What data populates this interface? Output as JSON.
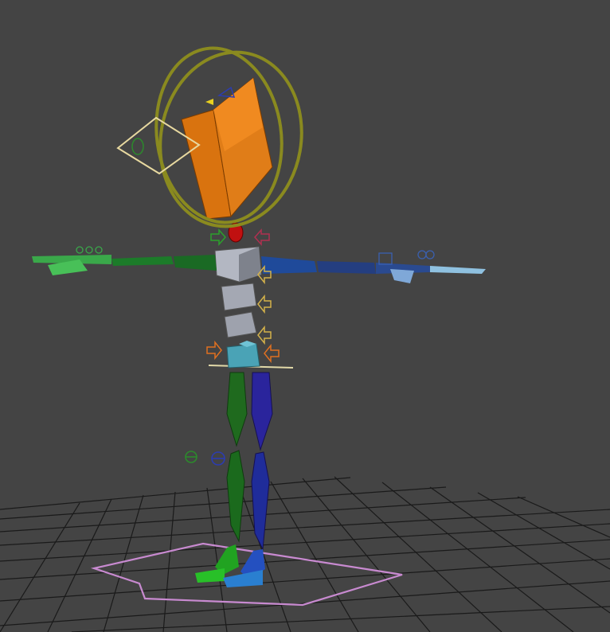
{
  "viewport": {
    "background": "#444444",
    "grid_color": "#1a1a1a"
  },
  "rig": {
    "head_color": "#d9730f",
    "ring_color": "#8a8a1f",
    "spine_color": "#8c909c",
    "pelvis_color": "#3a8ea0",
    "left_color": "#1e6e1e",
    "right_color": "#23238c",
    "left_arm_color": "#1d7a2a",
    "right_arm_color": "#1f3a7a",
    "footprint_color": "#c88ad0",
    "helper_color": "#d4b24a",
    "neck_color": "#c01010"
  }
}
